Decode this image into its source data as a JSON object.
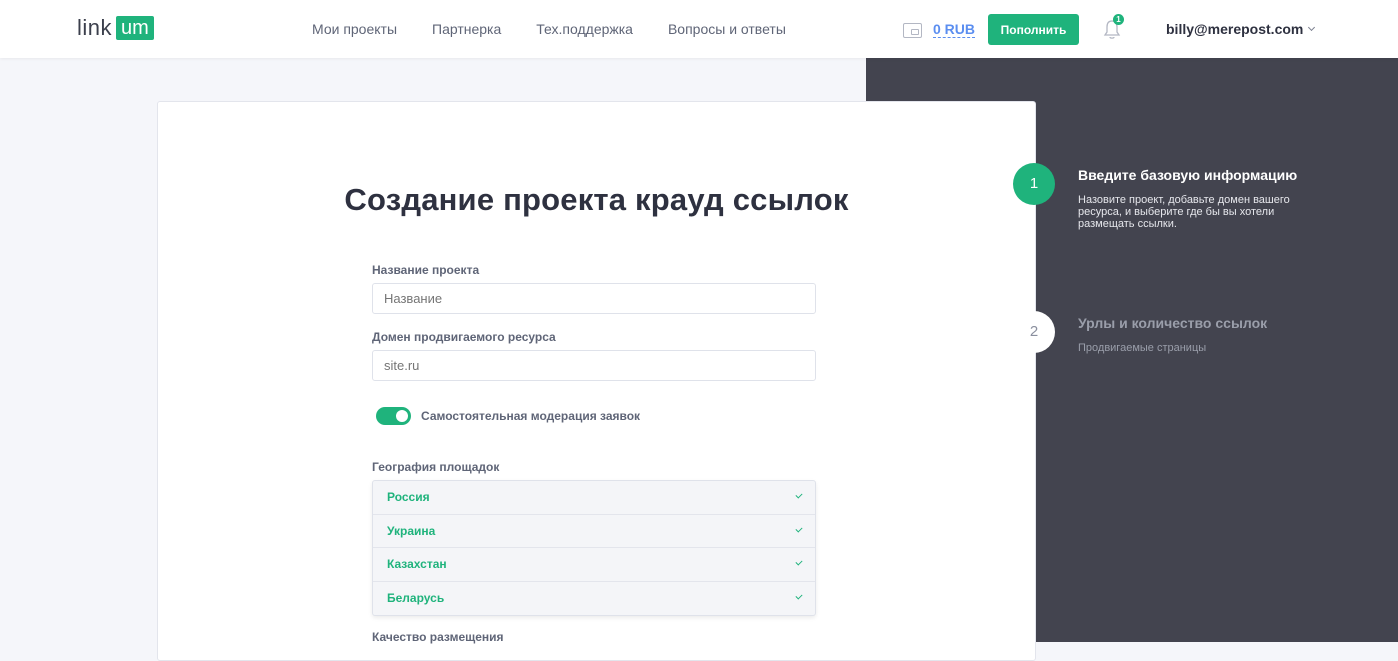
{
  "header": {
    "logo_text": "link",
    "logo_badge": "um",
    "nav": [
      {
        "label": "Мои проекты"
      },
      {
        "label": "Партнерка"
      },
      {
        "label": "Тех.поддержка"
      },
      {
        "label": "Вопросы и ответы"
      }
    ],
    "balance": "0 RUB",
    "topup_label": "Пополнить",
    "notification_count": "1",
    "user_email": "billy@merepost.com"
  },
  "form": {
    "title": "Создание проекта крауд ссылок",
    "project_name_label": "Название проекта",
    "project_name_placeholder": "Название",
    "domain_label": "Домен продвигаемого ресурса",
    "domain_placeholder": "site.ru",
    "moderation_label": "Самостоятельная модерация заявок",
    "moderation_enabled": true,
    "geo_label": "География площадок",
    "geo_options": [
      {
        "name": "Россия",
        "selected": true
      },
      {
        "name": "Украина",
        "selected": true
      },
      {
        "name": "Казахстан",
        "selected": true
      },
      {
        "name": "Беларусь",
        "selected": true
      }
    ],
    "quality_label": "Качество размещения"
  },
  "steps": [
    {
      "number": "1",
      "title": "Введите базовую информацию",
      "description": "Назовите проект, добавьте домен вашего ресурса, и выберите где бы вы хотели размещать ссылки.",
      "active": true
    },
    {
      "number": "2",
      "title": "Урлы и количество ссылок",
      "description": "Продвигаемые страницы",
      "active": false
    }
  ],
  "colors": {
    "accent": "#1fb37c",
    "side_panel": "#43444f",
    "link_blue": "#5b8ef0"
  }
}
